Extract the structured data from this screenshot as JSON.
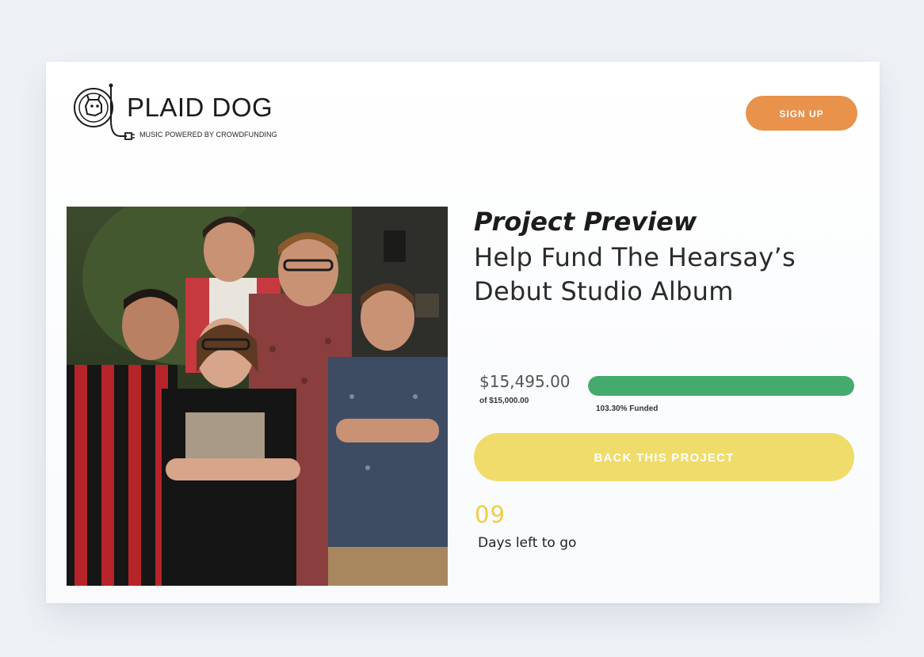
{
  "brand": {
    "name": "PLAID DOG",
    "tagline": "MUSIC POWERED BY CROWDFUNDING"
  },
  "header": {
    "signup_label": "SIGN UP",
    "signup_color": "#e8924b"
  },
  "project": {
    "preview_label": "Project Preview",
    "title": "Help Fund The Hearsay’s Debut Studio Album",
    "photo_icon": "band-photo-image"
  },
  "funding": {
    "raised": "$15,495.00",
    "goal": "of $15,000.00",
    "funded_text": "103.30% Funded",
    "funded_fraction": 1.033,
    "bar_color": "#45aa6e"
  },
  "cta": {
    "back_label": "BACK THIS PROJECT",
    "back_color": "#f0dc6a"
  },
  "countdown": {
    "days": "09",
    "label": "Days left to go",
    "days_color": "#f0ce45"
  }
}
